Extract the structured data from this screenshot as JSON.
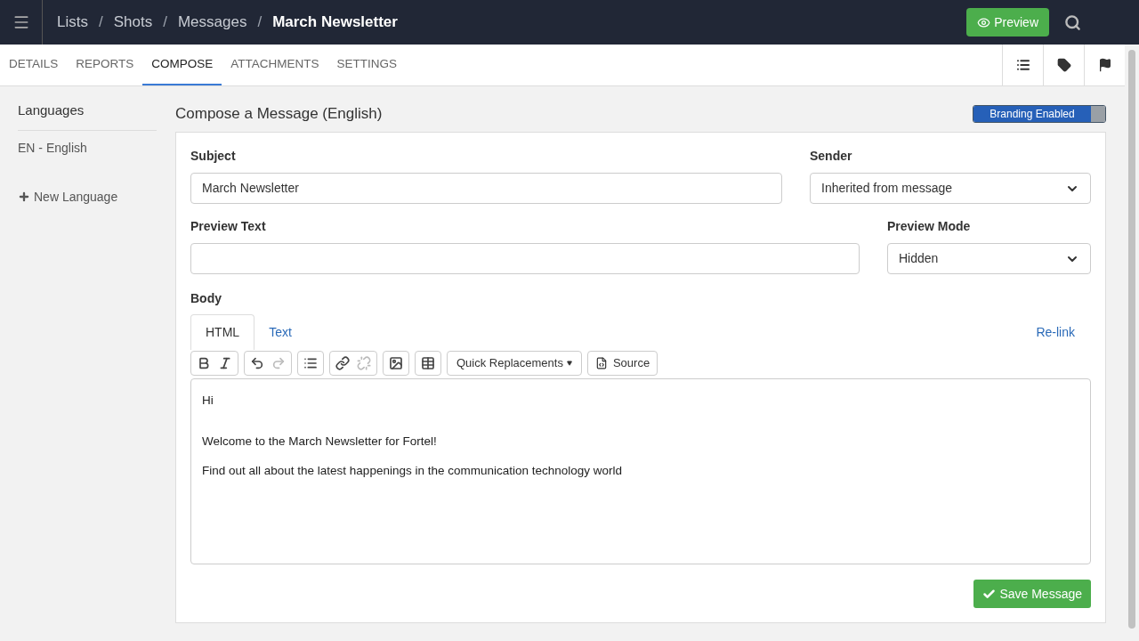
{
  "breadcrumb": [
    {
      "label": "Lists",
      "current": false
    },
    {
      "label": "Shots",
      "current": false
    },
    {
      "label": "Messages",
      "current": false
    },
    {
      "label": "March Newsletter",
      "current": true
    }
  ],
  "breadcrumb_separator": "/",
  "preview_button": "Preview",
  "tabs": [
    {
      "label": "DETAILS",
      "selected": false
    },
    {
      "label": "REPORTS",
      "selected": false
    },
    {
      "label": "COMPOSE",
      "selected": true
    },
    {
      "label": "ATTACHMENTS",
      "selected": false
    },
    {
      "label": "SETTINGS",
      "selected": false
    }
  ],
  "sidebar": {
    "title": "Languages",
    "items": [
      "EN - English"
    ],
    "add_button": "New Language"
  },
  "compose": {
    "title": "Compose a Message (English)",
    "branding_toggle": {
      "label": "Branding Enabled",
      "on": true
    },
    "subject": {
      "label": "Subject",
      "value": "March Newsletter"
    },
    "sender": {
      "label": "Sender",
      "value": "Inherited from message"
    },
    "preview_text": {
      "label": "Preview Text"
    },
    "preview_mode": {
      "label": "Preview Mode",
      "value": "Hidden"
    },
    "body": {
      "label": "Body",
      "tabs": [
        {
          "label": "HTML",
          "selected": true
        },
        {
          "label": "Text",
          "selected": false
        }
      ],
      "relink": "Re-link",
      "toolbar": [
        [
          {
            "kind": "bold",
            "disabled": false
          },
          {
            "kind": "italic",
            "disabled": false
          }
        ],
        [
          {
            "kind": "undo",
            "disabled": false
          },
          {
            "kind": "redo",
            "disabled": true
          }
        ],
        [
          {
            "kind": "list",
            "disabled": false
          }
        ],
        [
          {
            "kind": "link",
            "disabled": false
          },
          {
            "kind": "unlink",
            "disabled": true
          }
        ],
        [
          {
            "kind": "image",
            "disabled": false
          }
        ],
        [
          {
            "kind": "table",
            "disabled": false
          }
        ]
      ],
      "quick_replacements": "Quick Replacements",
      "source": "Source",
      "paragraphs": [
        "Hi",
        "Welcome to the March Newsletter for Fortel!",
        "Find out all about the latest happenings in the communication technology world"
      ]
    },
    "save_button": "Save Message"
  }
}
